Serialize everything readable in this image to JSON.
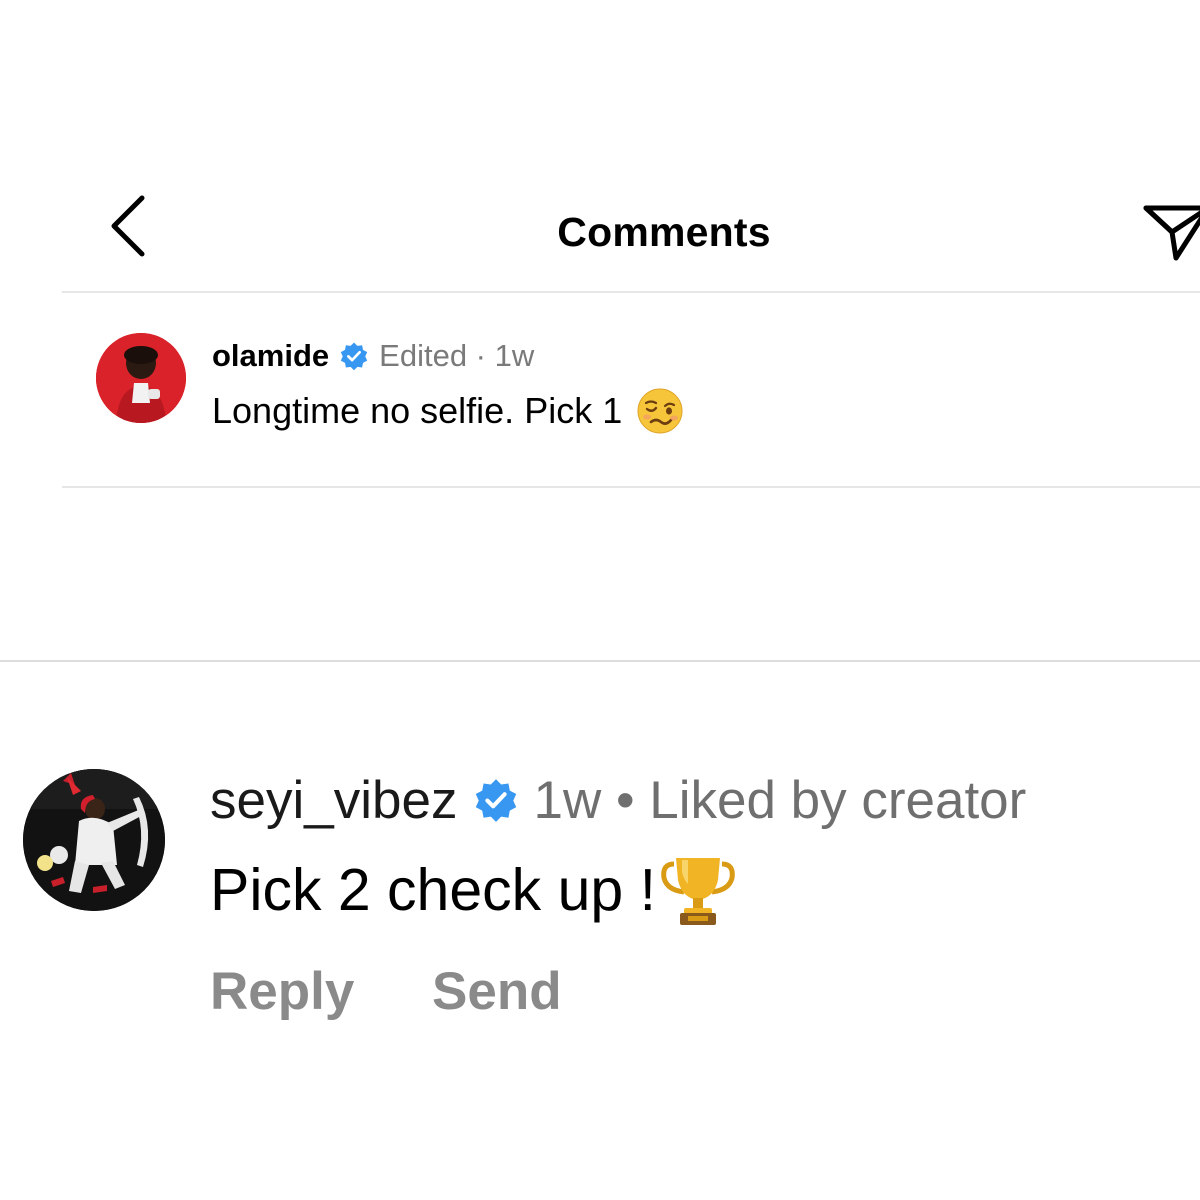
{
  "header": {
    "title": "Comments",
    "back_icon": "chevron-left-icon",
    "share_icon": "paper-plane-icon"
  },
  "caption": {
    "username": "olamide",
    "verified": true,
    "meta": "Edited · 1w",
    "text": "Longtime no selfie. Pick 1",
    "emoji": "woozy-face-icon"
  },
  "comments": [
    {
      "username": "seyi_vibez",
      "verified": true,
      "meta": "1w • Liked by creator",
      "text": "Pick 2 check up !",
      "emoji": "trophy-icon",
      "actions": {
        "reply_label": "Reply",
        "send_label": "Send"
      }
    }
  ],
  "colors": {
    "verified": "#3897f0",
    "meta_text": "#7a7a7a",
    "action_text": "#8a8a8a",
    "divider": "#e6e6e6",
    "avatar_olamide_bg": "#d9222a"
  }
}
